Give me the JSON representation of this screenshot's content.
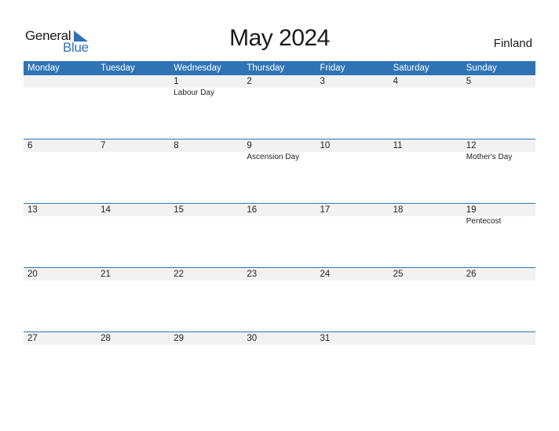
{
  "logo": {
    "line1": "General",
    "line2": "Blue",
    "icon": "triangle-flag-icon",
    "accent": "#2e74b5"
  },
  "title": "May 2024",
  "country": "Finland",
  "colors": {
    "header_bg": "#2e74b5",
    "band_bg": "#f2f2f2"
  },
  "weekdays": [
    "Monday",
    "Tuesday",
    "Wednesday",
    "Thursday",
    "Friday",
    "Saturday",
    "Sunday"
  ],
  "weeks": [
    {
      "days": [
        {
          "num": "",
          "holiday": ""
        },
        {
          "num": "",
          "holiday": ""
        },
        {
          "num": "1",
          "holiday": "Labour Day"
        },
        {
          "num": "2",
          "holiday": ""
        },
        {
          "num": "3",
          "holiday": ""
        },
        {
          "num": "4",
          "holiday": ""
        },
        {
          "num": "5",
          "holiday": ""
        }
      ]
    },
    {
      "days": [
        {
          "num": "6",
          "holiday": ""
        },
        {
          "num": "7",
          "holiday": ""
        },
        {
          "num": "8",
          "holiday": ""
        },
        {
          "num": "9",
          "holiday": "Ascension Day"
        },
        {
          "num": "10",
          "holiday": ""
        },
        {
          "num": "11",
          "holiday": ""
        },
        {
          "num": "12",
          "holiday": "Mother's Day"
        }
      ]
    },
    {
      "days": [
        {
          "num": "13",
          "holiday": ""
        },
        {
          "num": "14",
          "holiday": ""
        },
        {
          "num": "15",
          "holiday": ""
        },
        {
          "num": "16",
          "holiday": ""
        },
        {
          "num": "17",
          "holiday": ""
        },
        {
          "num": "18",
          "holiday": ""
        },
        {
          "num": "19",
          "holiday": "Pentecost"
        }
      ]
    },
    {
      "days": [
        {
          "num": "20",
          "holiday": ""
        },
        {
          "num": "21",
          "holiday": ""
        },
        {
          "num": "22",
          "holiday": ""
        },
        {
          "num": "23",
          "holiday": ""
        },
        {
          "num": "24",
          "holiday": ""
        },
        {
          "num": "25",
          "holiday": ""
        },
        {
          "num": "26",
          "holiday": ""
        }
      ]
    },
    {
      "days": [
        {
          "num": "27",
          "holiday": ""
        },
        {
          "num": "28",
          "holiday": ""
        },
        {
          "num": "29",
          "holiday": ""
        },
        {
          "num": "30",
          "holiday": ""
        },
        {
          "num": "31",
          "holiday": ""
        },
        {
          "num": "",
          "holiday": ""
        },
        {
          "num": "",
          "holiday": ""
        }
      ]
    }
  ]
}
